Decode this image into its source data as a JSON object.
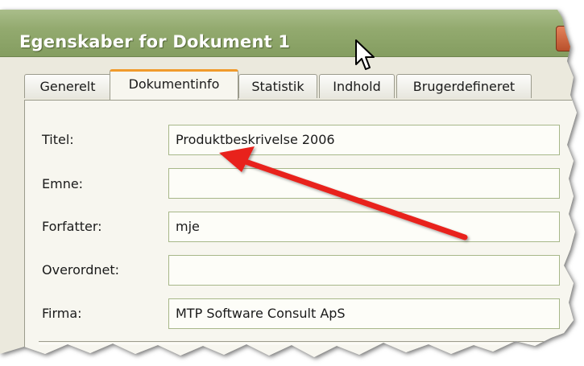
{
  "window": {
    "title": "Egenskaber for Dokument 1",
    "accent_color": "#f09a2c",
    "titlebar_color": "#93aa6f"
  },
  "tabs": [
    {
      "label": "Generelt",
      "active": false
    },
    {
      "label": "Dokumentinfo",
      "active": true
    },
    {
      "label": "Statistik",
      "active": false
    },
    {
      "label": "Indhold",
      "active": false
    },
    {
      "label": "Brugerdefineret",
      "active": false
    }
  ],
  "fields": [
    {
      "label": "Titel:",
      "value": "Produktbeskrivelse 2006"
    },
    {
      "label": "Emne:",
      "value": ""
    },
    {
      "label": "Forfatter:",
      "value": "mje"
    },
    {
      "label": "Overordnet:",
      "value": ""
    },
    {
      "label": "Firma:",
      "value": "MTP Software Consult ApS"
    }
  ],
  "annotation": {
    "icon": "red-arrow-icon",
    "color": "#e8231e"
  },
  "cursor": {
    "icon": "mouse-pointer-icon"
  }
}
